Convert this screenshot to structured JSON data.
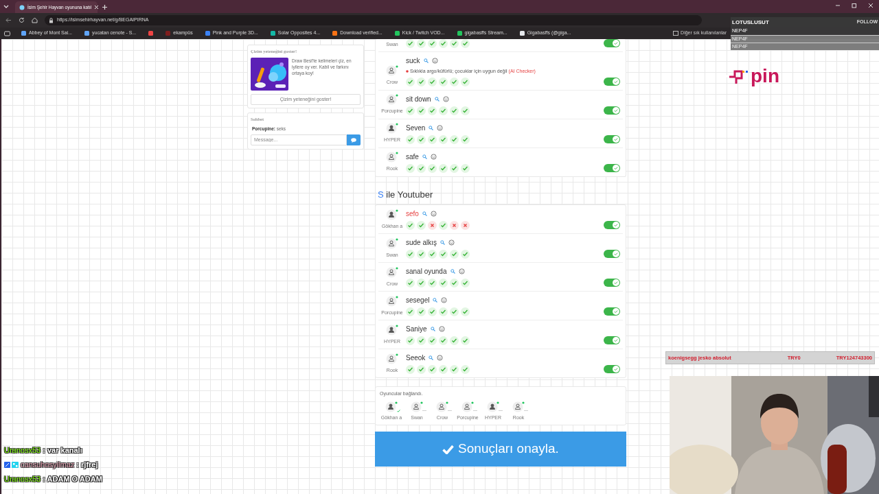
{
  "browser": {
    "tabs": [
      {
        "title": "İsim Şehir Hayvan oyununa katıl",
        "selected": true
      }
    ],
    "url": "https://isimsehirhayvan.net/g/BEGAIPIRNA",
    "bookmarks": [
      {
        "label": "Abbey of Mont Sai...",
        "color": "#60a5fa"
      },
      {
        "label": "yucatan cenote - S...",
        "color": "#60a5fa"
      },
      {
        "color": "#ef4444"
      },
      {
        "label": "ekampüs",
        "color": "#7f1d1d"
      },
      {
        "label": "Pink and Purple 3D...",
        "color": "#3b82f6"
      },
      {
        "label": "Solar Opposites 4...",
        "color": "#14b8a6"
      },
      {
        "label": "Download verified...",
        "color": "#f97316"
      },
      {
        "label": "Kick / Twitch VOD...",
        "color": "#22c55e"
      },
      {
        "label": "gigabasffs Stream...",
        "color": "#22c55e"
      },
      {
        "label": "Gigabasffs (@giga...",
        "color": "#e5e7eb"
      }
    ],
    "other_bookmarks": "Diğer sık kullanılanlar"
  },
  "promo": {
    "title": "Çizim yeteneğini goster!",
    "text": "Draw Best'te kelimeleri çiz, en iyilere oy ver. Kabil ve farkını ortaya koy!",
    "button": "Çizim yeteneğini goster!"
  },
  "chat": {
    "title": "Sohbet",
    "messages": [
      {
        "user": "Porcupine:",
        "text": "seks"
      }
    ],
    "placeholder": "Message..."
  },
  "sections": [
    {
      "rows": [
        {
          "player": "Swan",
          "votes": [
            true,
            true,
            true,
            true,
            true,
            true
          ],
          "accepted": true
        },
        {
          "answer": "suck",
          "invalid": false,
          "online": true,
          "note": "Sıklıkla argo/küfürlü; çocuklar için uygun değil",
          "note_source": "(AI Checker)",
          "player": "Crow",
          "votes": [
            true,
            true,
            true,
            true,
            true,
            true
          ],
          "accepted": true
        },
        {
          "answer": "sit down",
          "invalid": false,
          "online": true,
          "player": "Porcupine",
          "votes": [
            true,
            true,
            true,
            true,
            true,
            true
          ],
          "accepted": true
        },
        {
          "answer": "Seven",
          "invalid": false,
          "online": true,
          "player": "HYPER",
          "votes": [
            true,
            true,
            true,
            true,
            true,
            true
          ],
          "accepted": true
        },
        {
          "answer": "safe",
          "invalid": false,
          "online": true,
          "player": "Rook",
          "votes": [
            true,
            true,
            true,
            true,
            true,
            true
          ],
          "accepted": true
        }
      ]
    },
    {
      "letter": "S",
      "title": "ile Youtuber",
      "rows": [
        {
          "answer": "sefo",
          "invalid": true,
          "online": true,
          "player": "Gökhan a",
          "votes": [
            true,
            true,
            false,
            true,
            false,
            false
          ],
          "accepted": true
        },
        {
          "answer": "sude alkış",
          "invalid": false,
          "online": true,
          "player": "Swan",
          "votes": [
            true,
            true,
            true,
            true,
            true,
            true
          ],
          "accepted": true
        },
        {
          "answer": "sanal oyunda",
          "invalid": false,
          "online": true,
          "player": "Crow",
          "votes": [
            true,
            true,
            true,
            true,
            true,
            true
          ],
          "accepted": true
        },
        {
          "answer": "sesegel",
          "invalid": false,
          "online": true,
          "player": "Porcupine",
          "votes": [
            true,
            true,
            true,
            true,
            true,
            true
          ],
          "accepted": true
        },
        {
          "answer": "Saniye",
          "invalid": false,
          "online": true,
          "player": "HYPER",
          "votes": [
            true,
            true,
            true,
            true,
            true,
            true
          ],
          "accepted": true
        },
        {
          "answer": "Seeok",
          "invalid": false,
          "online": true,
          "player": "Rook",
          "votes": [
            true,
            true,
            true,
            true,
            true,
            true
          ],
          "accepted": true
        }
      ]
    }
  ],
  "players": {
    "title": "Oyuncular bağlandı.",
    "items": [
      {
        "name": "Gökhan a",
        "ready": true
      },
      {
        "name": "Swan",
        "ready": false
      },
      {
        "name": "Crow",
        "ready": false
      },
      {
        "name": "Porcupine",
        "ready": false
      },
      {
        "name": "HYPER",
        "ready": false
      },
      {
        "name": "Rook",
        "ready": false
      }
    ]
  },
  "confirm_button": "Sonuçları onayla.",
  "overlay": {
    "follow_title": "LOTUSLUSUT",
    "follow_label": "FOLLOW",
    "followers": [
      "NEP4F",
      "NEP4F",
      "NEP4F"
    ],
    "logo_text": "pin",
    "donation": {
      "item": "koenigsegg jesko absolut",
      "amount": "TRY0",
      "total": "TRY124743300"
    },
    "stream_chat": [
      {
        "user": "Uranosx53",
        "color": "#7cfc00",
        "text": ": var kanalı",
        "badges": false
      },
      {
        "user": "cansuhosyilmaz",
        "color": "#e8a3b5",
        "text": ": rjfrej",
        "badges": true
      },
      {
        "user": "Uranosx53",
        "color": "#7cfc00",
        "text": ": ADAM O ADAM",
        "badges": false
      }
    ]
  }
}
